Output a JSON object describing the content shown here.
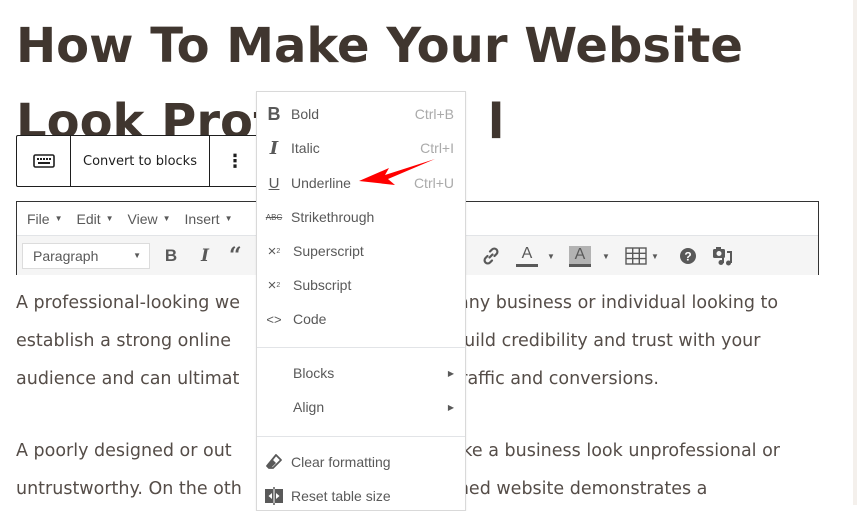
{
  "document": {
    "title": "How To Make Your Website Look Professional",
    "title_line1": "How To Make Your Website",
    "title_line2_visible_left": "Look Prof",
    "title_line2_visible_right": "l",
    "paragraphs": [
      {
        "lines": [
          {
            "left": "A professional-looking we",
            "right": "any business or individual looking to"
          },
          {
            "left": "establish a strong online",
            "right": "build credibility and trust with your"
          },
          {
            "left": "audience and can ultimat",
            "right": "traffic and conversions."
          }
        ]
      },
      {
        "lines": [
          {
            "left": "A poorly designed or out",
            "right": "ake a business look unprofessional or"
          },
          {
            "left": "untrustworthy. On the oth",
            "right": "ned website demonstrates a"
          }
        ]
      }
    ]
  },
  "block_toolbar": {
    "keyboard_icon": "keyboard-icon",
    "convert_label": "Convert to blocks",
    "more_icon": "⋮"
  },
  "editor": {
    "menubar": [
      {
        "label": "File"
      },
      {
        "label": "Edit"
      },
      {
        "label": "View"
      },
      {
        "label": "Insert"
      }
    ],
    "format_select": {
      "value": "Paragraph"
    },
    "toolbar_icons": [
      "bold",
      "italic",
      "blockquote",
      "link",
      "text-color",
      "background-color",
      "table",
      "help",
      "media"
    ],
    "text_color": "#595959",
    "bg_color_swatch": "#b3b3b3"
  },
  "context_menu": {
    "items": [
      {
        "icon": "bold-icon",
        "label": "Bold",
        "shortcut": "Ctrl+B"
      },
      {
        "icon": "italic-icon",
        "label": "Italic",
        "shortcut": "Ctrl+I"
      },
      {
        "icon": "underline-icon",
        "label": "Underline",
        "shortcut": "Ctrl+U"
      },
      {
        "icon": "strikethrough-icon",
        "label": "Strikethrough",
        "shortcut": ""
      },
      {
        "icon": "superscript-icon",
        "label": "Superscript",
        "shortcut": ""
      },
      {
        "icon": "subscript-icon",
        "label": "Subscript",
        "shortcut": ""
      },
      {
        "icon": "code-icon",
        "label": "Code",
        "shortcut": ""
      }
    ],
    "submenus": [
      {
        "label": "Blocks"
      },
      {
        "label": "Align"
      }
    ],
    "actions": [
      {
        "icon": "eraser-icon",
        "label": "Clear formatting"
      },
      {
        "icon": "table-resize-icon",
        "label": "Reset table size"
      }
    ]
  },
  "annotation": {
    "arrow_color": "#ff0000",
    "points_to": "Underline"
  }
}
